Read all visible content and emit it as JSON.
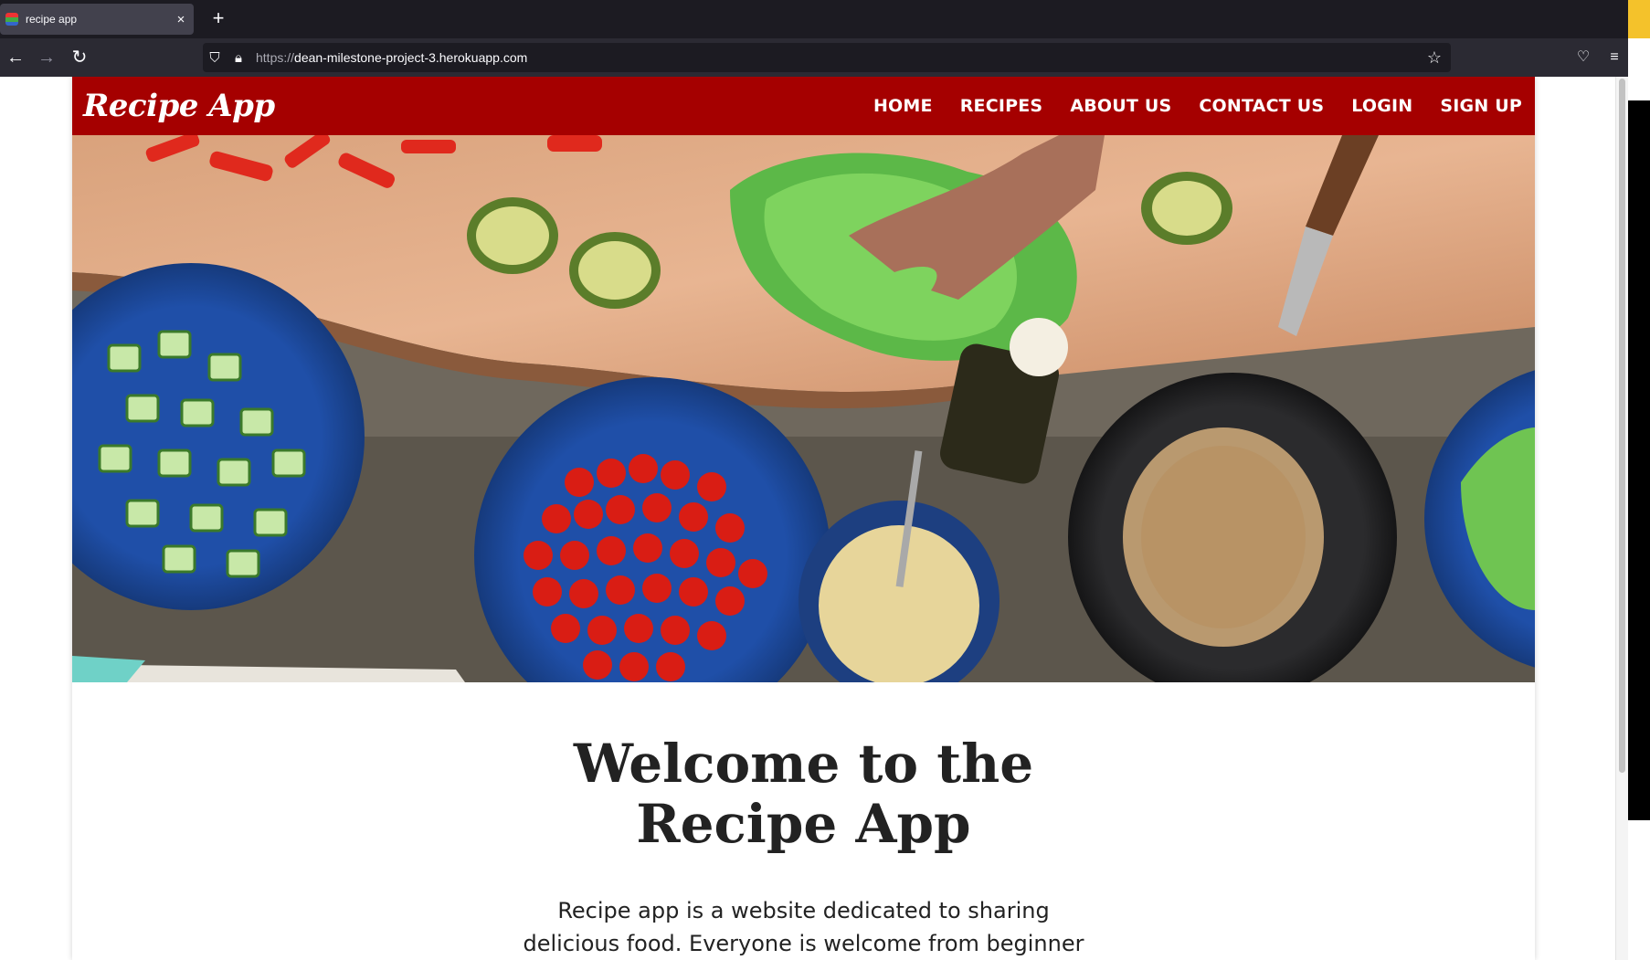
{
  "browser": {
    "tab_title": "recipe app",
    "close_symbol": "×",
    "new_tab_symbol": "+",
    "url_protocol": "https://",
    "url_host": "dean-milestone-project-3.herokuapp.com"
  },
  "site": {
    "brand": "Recipe App",
    "nav": [
      "HOME",
      "RECIPES",
      "ABOUT US",
      "CONTACT US",
      "LOGIN",
      "SIGN UP"
    ],
    "header_color": "#a50000"
  },
  "welcome": {
    "title_line1": "Welcome to the",
    "title_line2": "Recipe App",
    "intro": "Recipe app is a website dedicated to sharing delicious food. Everyone is welcome from beginner cooks to"
  }
}
